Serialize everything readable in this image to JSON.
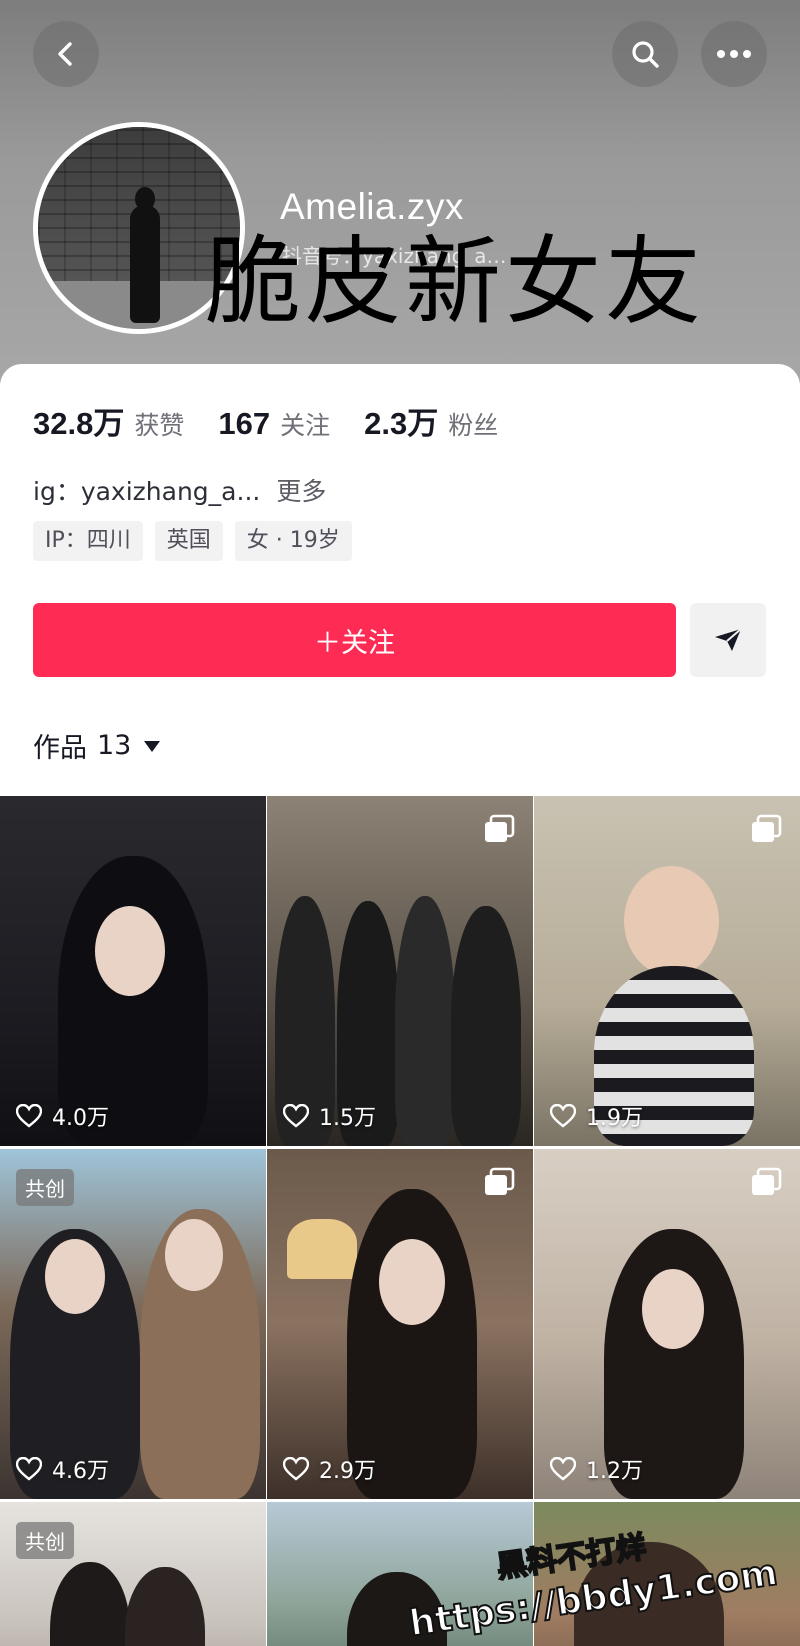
{
  "header": {
    "username": "Amelia.zyx",
    "douyin_id": "抖音号：yaxizhang_a…",
    "overlay_title": "脆皮新女友"
  },
  "stats": [
    {
      "num": "32.8万",
      "label": "获赞"
    },
    {
      "num": "167",
      "label": "关注"
    },
    {
      "num": "2.3万",
      "label": "粉丝"
    }
  ],
  "bio": {
    "text": "ig：yaxizhang_a...",
    "more": "更多"
  },
  "tags": [
    "IP：四川",
    "英国",
    "女 · 19岁"
  ],
  "actions": {
    "follow_label": "＋关注"
  },
  "works": {
    "label": "作品",
    "count": "13"
  },
  "grid": [
    {
      "likes": "4.0万",
      "badge": "",
      "multi": false
    },
    {
      "likes": "1.5万",
      "badge": "",
      "multi": true
    },
    {
      "likes": "1.9万",
      "badge": "",
      "multi": true
    },
    {
      "likes": "4.6万",
      "badge": "共创",
      "multi": false
    },
    {
      "likes": "2.9万",
      "badge": "",
      "multi": true
    },
    {
      "likes": "1.2万",
      "badge": "",
      "multi": true
    },
    {
      "likes": "",
      "badge": "共创",
      "multi": false
    },
    {
      "likes": "",
      "badge": "",
      "multi": false
    },
    {
      "likes": "",
      "badge": "",
      "multi": false
    }
  ],
  "watermark": {
    "line1": "黑料不打烊",
    "line2": "https://bbdy1.com"
  },
  "colors": {
    "accent": "#fe2c55",
    "text": "#161823",
    "secondary": "#6f7078"
  }
}
